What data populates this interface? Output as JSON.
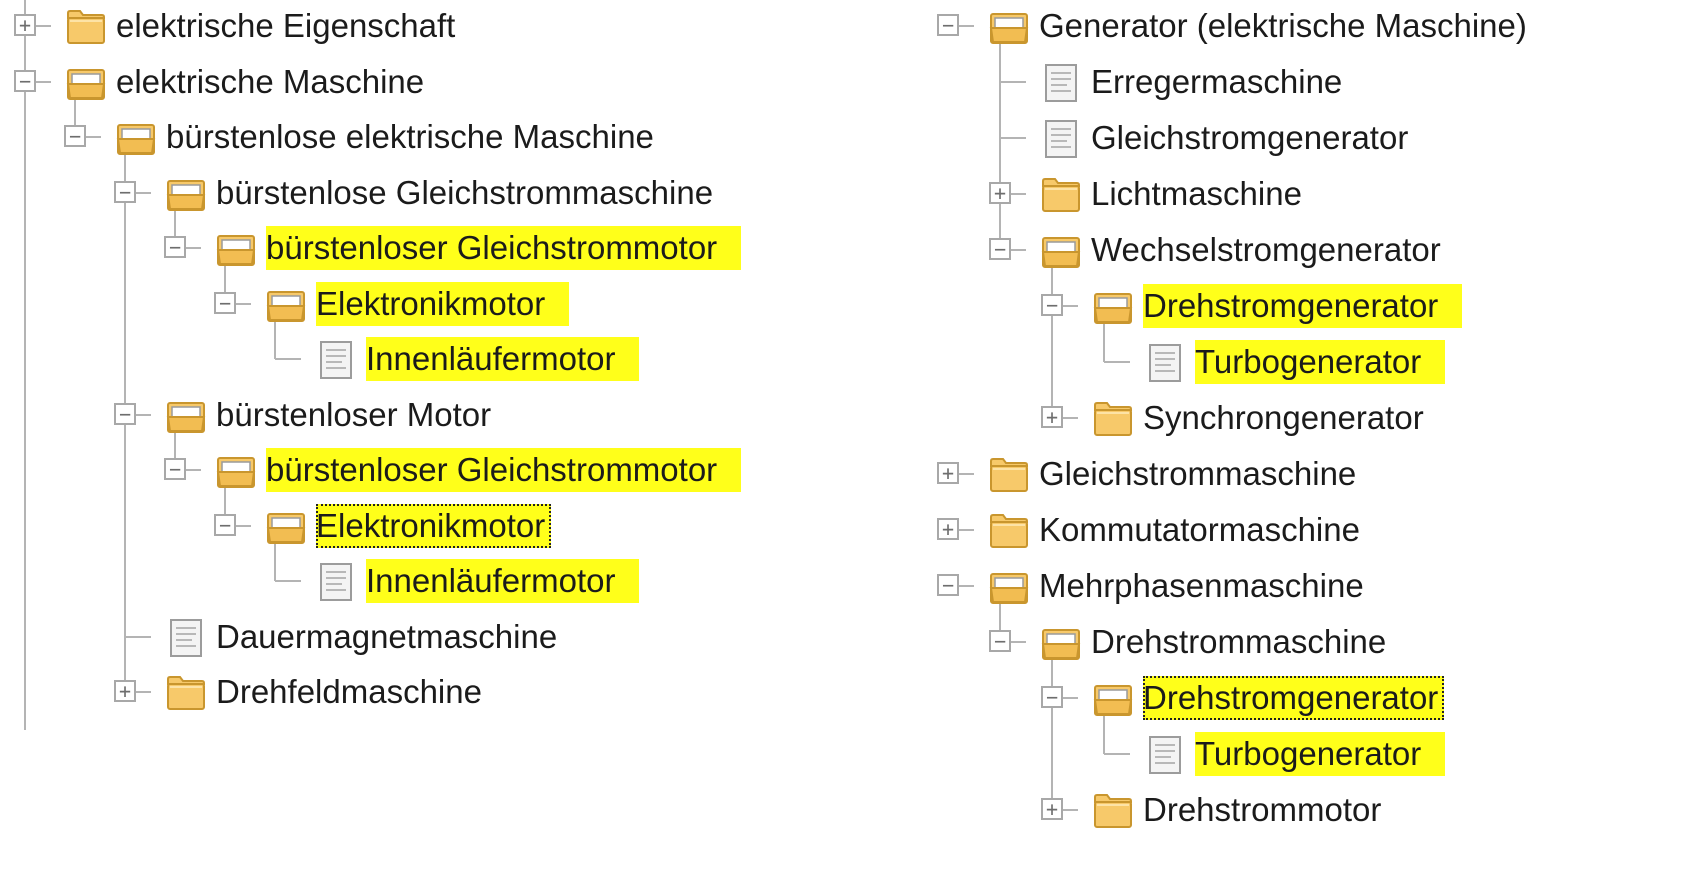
{
  "tree_left": [
    {
      "label": "elektrische Eigenschaft",
      "depth": 0,
      "toggle": "+",
      "icon": "closed-folder-icon",
      "highlighted": false
    },
    {
      "label": "elektrische Maschine",
      "depth": 0,
      "toggle": "−",
      "icon": "open-folder-icon",
      "highlighted": false
    },
    {
      "label": "bürstenlose elektrische Maschine",
      "depth": 1,
      "toggle": "−",
      "icon": "open-folder-icon",
      "highlighted": false
    },
    {
      "label": "bürstenlose Gleichstrommaschine",
      "depth": 2,
      "toggle": "−",
      "icon": "open-folder-icon",
      "highlighted": false
    },
    {
      "label": "bürstenloser Gleichstrommotor",
      "depth": 3,
      "toggle": "−",
      "icon": "open-folder-icon",
      "highlighted": true
    },
    {
      "label": "Elektronikmotor",
      "depth": 4,
      "toggle": "−",
      "icon": "open-folder-icon",
      "highlighted": true
    },
    {
      "label": "Innenläufermotor",
      "depth": 5,
      "toggle": "",
      "icon": "document-icon",
      "highlighted": true
    },
    {
      "label": "bürstenloser Motor",
      "depth": 2,
      "toggle": "−",
      "icon": "open-folder-icon",
      "highlighted": false
    },
    {
      "label": "bürstenloser Gleichstrommotor",
      "depth": 3,
      "toggle": "−",
      "icon": "open-folder-icon",
      "highlighted": true
    },
    {
      "label": "Elektronikmotor",
      "depth": 4,
      "toggle": "−",
      "icon": "open-folder-icon",
      "highlighted": true,
      "focused": true
    },
    {
      "label": "Innenläufermotor",
      "depth": 5,
      "toggle": "",
      "icon": "document-icon",
      "highlighted": true
    },
    {
      "label": "Dauermagnetmaschine",
      "depth": 2,
      "toggle": "",
      "icon": "document-icon",
      "highlighted": false
    },
    {
      "label": "Drehfeldmaschine",
      "depth": 2,
      "toggle": "+",
      "icon": "closed-folder-icon",
      "highlighted": false
    }
  ],
  "tree_right": [
    {
      "label": "Generator (elektrische Maschine)",
      "depth": 0,
      "toggle": "−",
      "icon": "open-folder-icon",
      "highlighted": false
    },
    {
      "label": "Erregermaschine",
      "depth": 1,
      "toggle": "",
      "icon": "document-icon",
      "highlighted": false
    },
    {
      "label": "Gleichstromgenerator",
      "depth": 1,
      "toggle": "",
      "icon": "document-icon",
      "highlighted": false
    },
    {
      "label": "Lichtmaschine",
      "depth": 1,
      "toggle": "+",
      "icon": "closed-folder-icon",
      "highlighted": false
    },
    {
      "label": "Wechselstromgenerator",
      "depth": 1,
      "toggle": "−",
      "icon": "open-folder-icon",
      "highlighted": false
    },
    {
      "label": "Drehstromgenerator",
      "depth": 2,
      "toggle": "−",
      "icon": "open-folder-icon",
      "highlighted": true
    },
    {
      "label": "Turbogenerator",
      "depth": 3,
      "toggle": "",
      "icon": "document-icon",
      "highlighted": true
    },
    {
      "label": "Synchrongenerator",
      "depth": 2,
      "toggle": "+",
      "icon": "closed-folder-icon",
      "highlighted": false
    },
    {
      "label": "Gleichstrommaschine",
      "depth": 0,
      "toggle": "+",
      "icon": "closed-folder-icon",
      "highlighted": false
    },
    {
      "label": "Kommutatormaschine",
      "depth": 0,
      "toggle": "+",
      "icon": "closed-folder-icon",
      "highlighted": false
    },
    {
      "label": "Mehrphasenmaschine",
      "depth": 0,
      "toggle": "−",
      "icon": "open-folder-icon",
      "highlighted": false
    },
    {
      "label": "Drehstrommaschine",
      "depth": 1,
      "toggle": "−",
      "icon": "open-folder-icon",
      "highlighted": false
    },
    {
      "label": "Drehstromgenerator",
      "depth": 2,
      "toggle": "−",
      "icon": "open-folder-icon",
      "highlighted": true,
      "focused": true
    },
    {
      "label": "Turbogenerator",
      "depth": 3,
      "toggle": "",
      "icon": "document-icon",
      "highlighted": true
    },
    {
      "label": "Drehstrommotor",
      "depth": 2,
      "toggle": "+",
      "icon": "closed-folder-icon",
      "highlighted": false
    }
  ],
  "colors": {
    "highlight": "#ffff1a",
    "folder": "#f7c96a",
    "folder_edge": "#c9962e",
    "connector": "#b4b4b4",
    "text": "#1b1b1b"
  }
}
